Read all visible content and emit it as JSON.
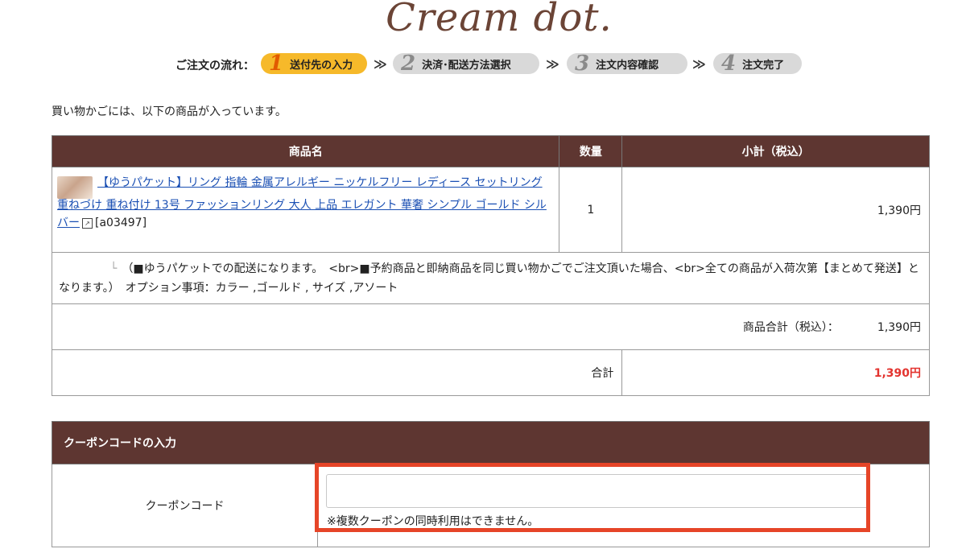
{
  "logo": "Cream dot.",
  "steps": {
    "label": "ご注文の流れ：",
    "items": [
      {
        "num": "1",
        "label": "送付先の入力"
      },
      {
        "num": "2",
        "label": "決済･配送方法選択"
      },
      {
        "num": "3",
        "label": "注文内容確認"
      },
      {
        "num": "4",
        "label": "注文完了"
      }
    ],
    "arrow": "≫"
  },
  "intro": "買い物かごには、以下の商品が入っています。",
  "cart": {
    "headers": [
      "商品名",
      "数量",
      "小計（税込）"
    ],
    "item": {
      "name": "【ゆうパケット】リング 指輪 金属アレルギー ニッケルフリー レディース セットリング 重ねづけ 重ね付け 13号 ファッションリング 大人 上品 エレガント 華奢 シンプル ゴールド シルバー",
      "code": "[a03497]",
      "quantity": "1",
      "subtotal": "1,390円"
    },
    "option_branch": "└",
    "option_text": "（■ゆうパケットでの配送になります。　<br>■予約商品と即納商品を同じ買い物かごでご注文頂いた場合、<br>全ての商品が入荷次第【まとめて発送】となります。）　オプション事項：カラー ,ゴールド , サイズ ,アソート",
    "subtotal_label": "商品合計（税込）：",
    "subtotal_value": "1,390円",
    "total_label": "合計",
    "total_value": "1,390円"
  },
  "coupon": {
    "header": "クーポンコードの入力",
    "label": "クーポンコード",
    "input_value": "",
    "note": "※複数クーポンの同時利用はできません。"
  },
  "colors": {
    "header_bg": "#5e3631",
    "step_active": "#f6b92a",
    "step_inactive": "#d9d9d9",
    "total_red": "#e3342f",
    "highlight": "#e64528",
    "link": "#1a4fb3"
  }
}
